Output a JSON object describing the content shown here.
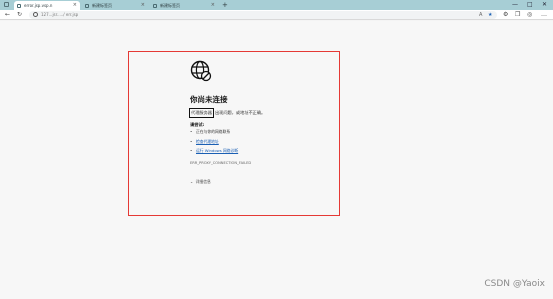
{
  "browser": {
    "tabs": [
      {
        "title": "error.jsp.vsp.n",
        "active": true
      },
      {
        "title": "新建标签页",
        "active": false
      },
      {
        "title": "新建标签页",
        "active": false
      }
    ],
    "new_tab": "+",
    "window_controls": {
      "minimize": "—",
      "maximize": "□",
      "close": "✕"
    },
    "address": "127...jsr...../ err.jsp",
    "icons": [
      "back-icon",
      "refresh-icon",
      "info-icon",
      "read-aloud-icon",
      "favorite-star-icon",
      "extensions-icon",
      "collections-icon",
      "profile-icon",
      "more-icon"
    ]
  },
  "error_page": {
    "title": "你尚未连接",
    "reason_boxed": "代理服务器",
    "reason_rest": "出现问题，或地址不正确。",
    "try_label": "请尝试:",
    "tips": [
      {
        "text": "正在与你的网络联系",
        "link": false
      },
      {
        "text": "检查代理地址",
        "link": true
      },
      {
        "text": "运行 Windows 网络诊断",
        "link": true
      }
    ],
    "error_code": "ERR_PROXY_CONNECTION_FAILED",
    "details_label": "详细信息"
  },
  "watermark": "CSDN @Yaoix",
  "colors": {
    "highlight_border": "#e53935",
    "link": "#1a5fb4",
    "tabstrip": "#a7ced5"
  }
}
